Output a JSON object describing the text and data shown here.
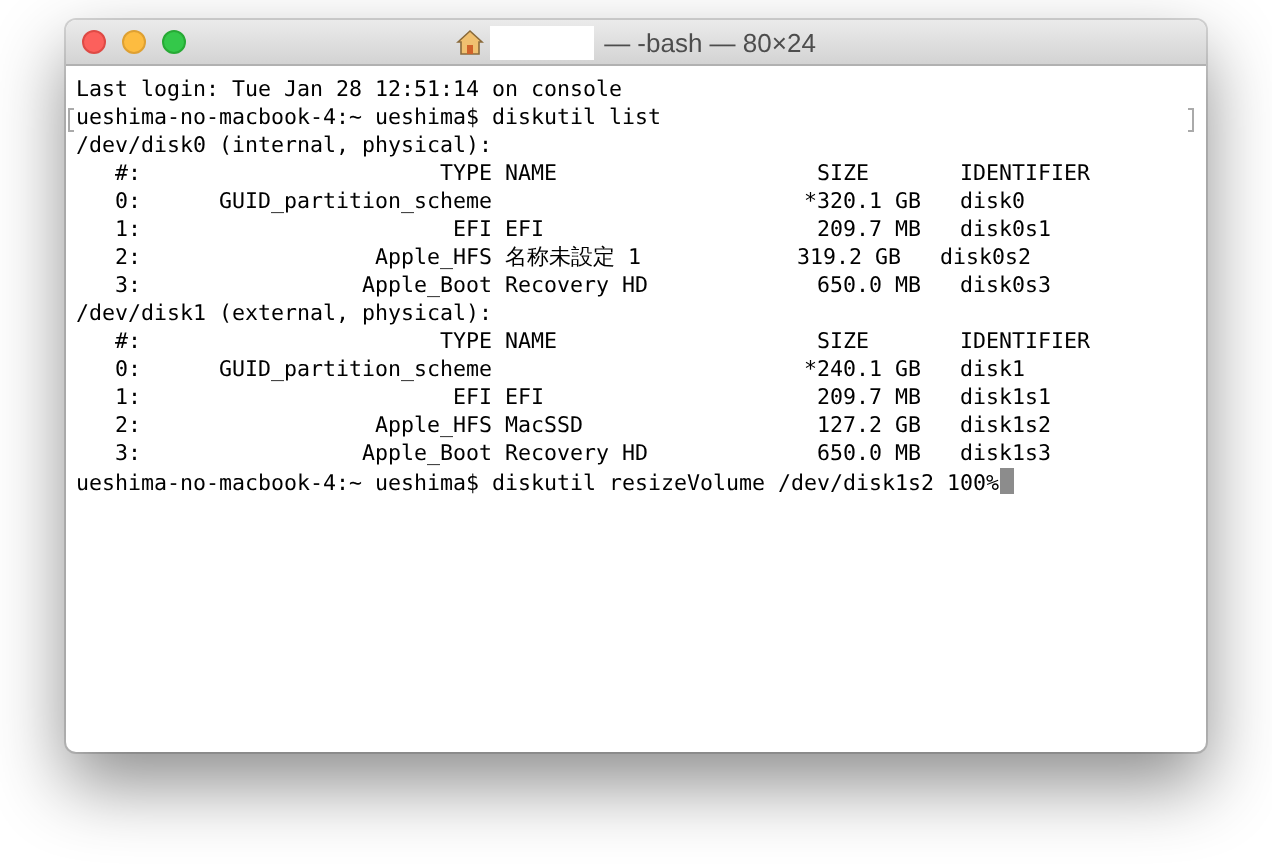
{
  "window": {
    "title": "— -bash — 80×24"
  },
  "terminal": {
    "lines": [
      {
        "text": "Last login: Tue Jan 28 12:51:14 on console",
        "marked": false,
        "cursor": false
      },
      {
        "text": "ueshima-no-macbook-4:~ ueshima$ diskutil list",
        "marked": true,
        "cursor": false
      },
      {
        "text": "/dev/disk0 (internal, physical):",
        "marked": false,
        "cursor": false
      },
      {
        "text": "   #:                       TYPE NAME                    SIZE       IDENTIFIER",
        "marked": false,
        "cursor": false
      },
      {
        "text": "   0:      GUID_partition_scheme                        *320.1 GB   disk0",
        "marked": false,
        "cursor": false
      },
      {
        "text": "   1:                        EFI EFI                     209.7 MB   disk0s1",
        "marked": false,
        "cursor": false
      },
      {
        "text": "   2:                  Apple_HFS 名称未設定 1            319.2 GB   disk0s2",
        "marked": false,
        "cursor": false
      },
      {
        "text": "   3:                 Apple_Boot Recovery HD             650.0 MB   disk0s3",
        "marked": false,
        "cursor": false
      },
      {
        "text": "/dev/disk1 (external, physical):",
        "marked": false,
        "cursor": false
      },
      {
        "text": "   #:                       TYPE NAME                    SIZE       IDENTIFIER",
        "marked": false,
        "cursor": false
      },
      {
        "text": "   0:      GUID_partition_scheme                        *240.1 GB   disk1",
        "marked": false,
        "cursor": false
      },
      {
        "text": "   1:                        EFI EFI                     209.7 MB   disk1s1",
        "marked": false,
        "cursor": false
      },
      {
        "text": "   2:                  Apple_HFS MacSSD                  127.2 GB   disk1s2",
        "marked": false,
        "cursor": false
      },
      {
        "text": "   3:                 Apple_Boot Recovery HD             650.0 MB   disk1s3",
        "marked": false,
        "cursor": false
      },
      {
        "text": "ueshima-no-macbook-4:~ ueshima$ diskutil resizeVolume /dev/disk1s2 100%",
        "marked": false,
        "cursor": true
      }
    ]
  }
}
